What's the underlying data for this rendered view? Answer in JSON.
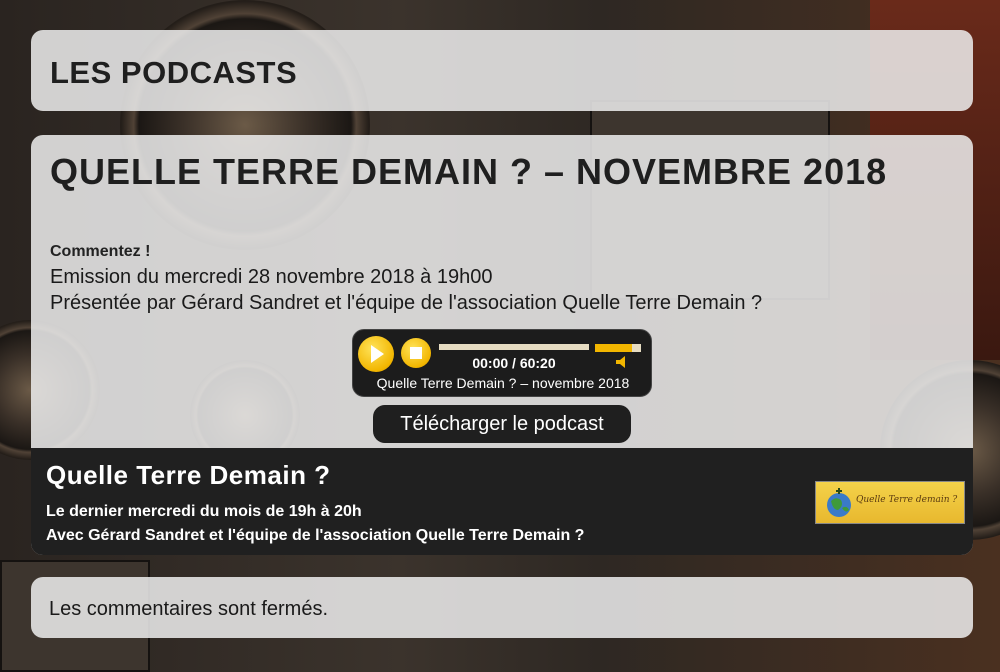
{
  "header": {
    "title": "LES PODCASTS"
  },
  "post": {
    "title": "QUELLE TERRE DEMAIN ? – NOVEMBRE 2018",
    "comment_link": "Commentez !",
    "description": [
      "Emission du mercredi 28 novembre 2018 à 19h00",
      "Présentée par Gérard Sandret et l'équipe de l'association Quelle Terre Demain ?"
    ]
  },
  "player": {
    "time": "00:00 / 60:20",
    "track": "Quelle Terre Demain ? – novembre 2018",
    "progress_fraction": 0,
    "volume_fraction": 0.8,
    "accent_color": "#f2b600"
  },
  "download": {
    "label": "Télécharger le podcast"
  },
  "show": {
    "title": "Quelle Terre Demain ?",
    "schedule": "Le dernier mercredi du mois de 19h à 20h",
    "host": "Avec Gérard Sandret et l'équipe de l'association Quelle Terre Demain ?",
    "logo_text": "Quelle Terre demain ?"
  },
  "comments": {
    "status": "Les commentaires sont fermés."
  }
}
